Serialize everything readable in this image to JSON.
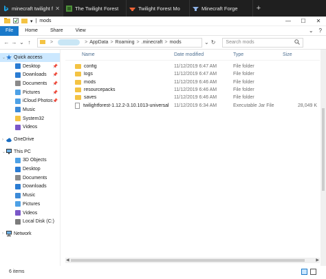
{
  "browser": {
    "tabs": [
      {
        "title": "minecraft twilight f",
        "favicon": "bing-icon",
        "color": "#1aa1e1"
      },
      {
        "title": "The Twilight Forest",
        "favicon": "twilight-forest-icon",
        "color": "#4e8f3a"
      },
      {
        "title": "Twilight Forest Mo",
        "favicon": "curseforge-icon",
        "color": "#f16436"
      },
      {
        "title": "Minecraft Forge",
        "favicon": "forge-icon",
        "color": "#3c5a8a"
      }
    ],
    "new_tab_label": "+"
  },
  "window": {
    "title": "mods",
    "controls": {
      "minimize": "—",
      "maximize": "☐",
      "close": "✕"
    }
  },
  "ribbon": {
    "file": "File",
    "tabs": [
      "Home",
      "Share",
      "View"
    ],
    "chevron": "⌄",
    "help": "?"
  },
  "address": {
    "breadcrumbs": [
      "AppData",
      "Roaming",
      ".minecraft",
      "mods"
    ],
    "separator": ">",
    "search_placeholder": "Search mods"
  },
  "nav": {
    "quick_access": "Quick access",
    "quick_items": [
      "Desktop",
      "Downloads",
      "Documents",
      "Pictures",
      "iCloud Photos",
      "Music",
      "System32",
      "Videos"
    ],
    "pinned": [
      true,
      true,
      true,
      true,
      true,
      false,
      false,
      false
    ],
    "onedrive": "OneDrive",
    "this_pc": "This PC",
    "pc_items": [
      "3D Objects",
      "Desktop",
      "Documents",
      "Downloads",
      "Music",
      "Pictures",
      "Videos",
      "Local Disk (C:)"
    ],
    "network": "Network"
  },
  "columns": {
    "name": "Name",
    "date": "Date modified",
    "type": "Type",
    "size": "Size"
  },
  "files": [
    {
      "name": "config",
      "date": "11/12/2019 6:47 AM",
      "type": "File folder",
      "size": "",
      "kind": "folder"
    },
    {
      "name": "logs",
      "date": "11/12/2019 6:47 AM",
      "type": "File folder",
      "size": "",
      "kind": "folder"
    },
    {
      "name": "mods",
      "date": "11/12/2019 6:46 AM",
      "type": "File folder",
      "size": "",
      "kind": "folder"
    },
    {
      "name": "resourcepacks",
      "date": "11/12/2019 6:46 AM",
      "type": "File folder",
      "size": "",
      "kind": "folder"
    },
    {
      "name": "saves",
      "date": "11/12/2019 6:46 AM",
      "type": "File folder",
      "size": "",
      "kind": "folder"
    },
    {
      "name": "twilightforest-1.12.2-3.10.1013-universal",
      "date": "11/12/2019 6:34 AM",
      "type": "Executable Jar File",
      "size": "28,049 K",
      "kind": "file"
    }
  ],
  "status": {
    "item_count": "6 items"
  },
  "colors": {
    "accent": "#1979ca",
    "selection": "#cce8ff",
    "folder": "#f4c343",
    "header_text": "#4d6f91"
  }
}
